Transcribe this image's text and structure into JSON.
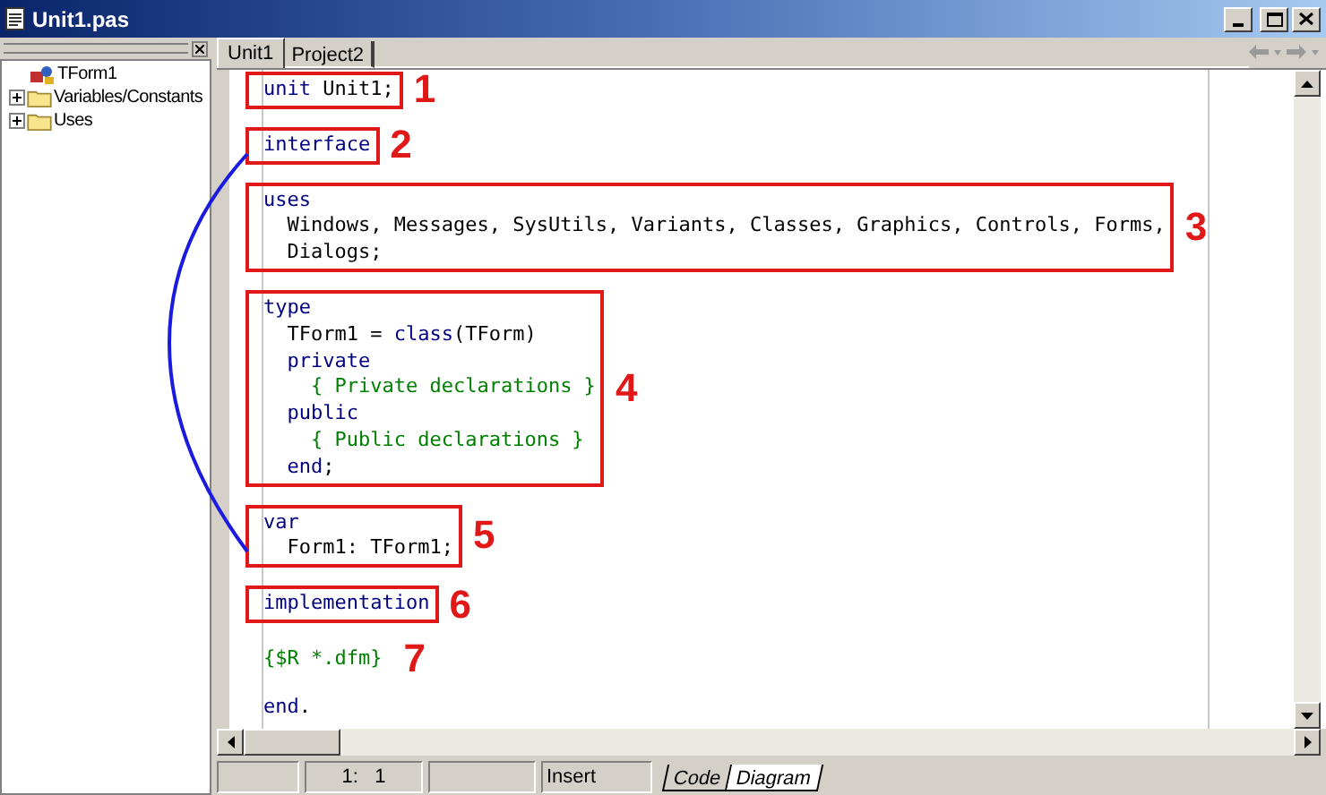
{
  "window": {
    "title": "Unit1.pas"
  },
  "structure_tree": [
    {
      "label": "TForm1",
      "kind": "form"
    },
    {
      "label": "Variables/Constants",
      "kind": "folder",
      "expanded": false
    },
    {
      "label": "Uses",
      "kind": "folder",
      "expanded": false
    }
  ],
  "tabs": [
    {
      "label": "Unit1",
      "selected": true
    },
    {
      "label": "Project2",
      "selected": false
    }
  ],
  "code_blocks": [
    {
      "callout": {
        "number": "1",
        "boxed": true
      },
      "lines": [
        [
          {
            "kind": "keyword",
            "text": "unit"
          },
          {
            "kind": "plain",
            "text": " Unit1;"
          }
        ]
      ]
    },
    {
      "callout": {
        "number": "2",
        "boxed": true
      },
      "lines": [
        [
          {
            "kind": "keyword",
            "text": "interface"
          }
        ]
      ]
    },
    {
      "callout": {
        "number": "3",
        "boxed": true
      },
      "lines": [
        [
          {
            "kind": "keyword",
            "text": "uses"
          }
        ],
        [
          {
            "kind": "plain",
            "text": "  Windows, Messages, SysUtils, Variants, Classes, Graphics, Controls, Forms,"
          }
        ],
        [
          {
            "kind": "plain",
            "text": "  Dialogs;"
          }
        ]
      ]
    },
    {
      "callout": {
        "number": "4",
        "boxed": true
      },
      "lines": [
        [
          {
            "kind": "keyword",
            "text": "type"
          }
        ],
        [
          {
            "kind": "plain",
            "text": "  TForm1 = "
          },
          {
            "kind": "keyword",
            "text": "class"
          },
          {
            "kind": "plain",
            "text": "(TForm)"
          }
        ],
        [
          {
            "kind": "keyword",
            "text": "  private"
          }
        ],
        [
          {
            "kind": "comment",
            "text": "    { Private declarations }"
          }
        ],
        [
          {
            "kind": "keyword",
            "text": "  public"
          }
        ],
        [
          {
            "kind": "comment",
            "text": "    { Public declarations }"
          }
        ],
        [
          {
            "kind": "keyword",
            "text": "  end"
          },
          {
            "kind": "plain",
            "text": ";"
          }
        ]
      ]
    },
    {
      "callout": {
        "number": "5",
        "boxed": true
      },
      "lines": [
        [
          {
            "kind": "keyword",
            "text": "var"
          }
        ],
        [
          {
            "kind": "plain",
            "text": "  Form1: TForm1;"
          }
        ]
      ]
    },
    {
      "callout": {
        "number": "6",
        "boxed": true
      },
      "lines": [
        [
          {
            "kind": "keyword",
            "text": "implementation"
          }
        ]
      ]
    },
    {
      "callout": {
        "number": "7",
        "boxed": false
      },
      "lines": [
        [
          {
            "kind": "directive",
            "text": "{$R *.dfm}"
          }
        ]
      ]
    },
    {
      "lines": [
        [
          {
            "kind": "keyword",
            "text": "end"
          },
          {
            "kind": "plain",
            "text": "."
          }
        ]
      ]
    }
  ],
  "status_bar": {
    "position": "1:   1",
    "mode": "Insert"
  },
  "view_tabs": [
    {
      "label": "Code",
      "selected": true
    },
    {
      "label": "Diagram",
      "selected": false
    }
  ]
}
